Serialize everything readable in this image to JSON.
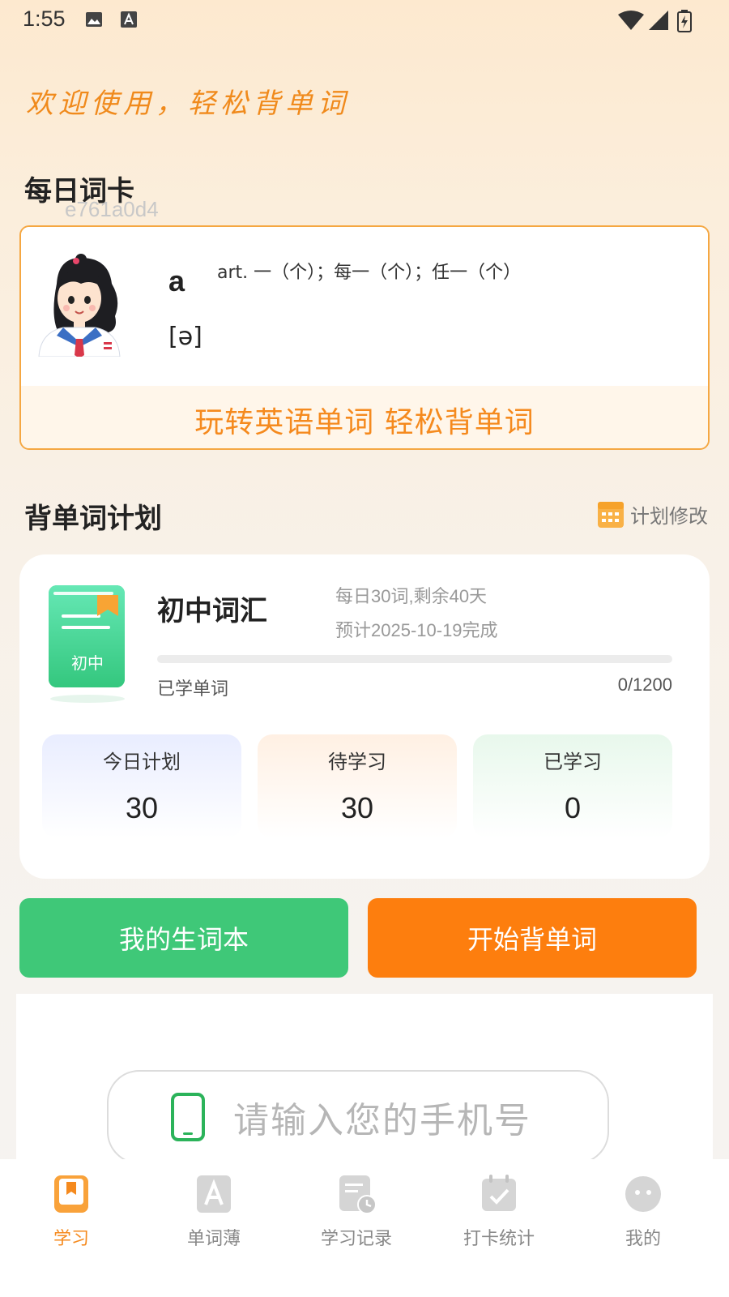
{
  "status_bar": {
    "time": "1:55"
  },
  "welcome_text": "欢迎使用，轻松背单词",
  "daily_card": {
    "title": "每日词卡",
    "subtitle": "e761a0d4",
    "word": "a",
    "meaning": "art. 一（个）；每一（个）；任一（个）",
    "phonetic": "[ə]",
    "slogan": "玩转英语单词  轻松背单词"
  },
  "plan": {
    "title": "背单词计划",
    "edit_label": "计划修改",
    "book_cover_label": "初中",
    "book_name": "初中词汇",
    "daily_info": "每日30词,剩余40天",
    "eta_info": "预计2025-10-19完成",
    "learned_label": "已学单词",
    "learned_count": "0/1200",
    "progress_fraction": 0,
    "stats": [
      {
        "label": "今日计划",
        "value": "30"
      },
      {
        "label": "待学习",
        "value": "30"
      },
      {
        "label": "已学习",
        "value": "0"
      }
    ]
  },
  "actions": {
    "vocab_book": "我的生词本",
    "start": "开始背单词"
  },
  "login": {
    "phone_placeholder": "请输入您的手机号"
  },
  "bottom_nav": [
    {
      "label": "学习",
      "icon": "book-icon",
      "active": true
    },
    {
      "label": "单词薄",
      "icon": "letter-a-icon",
      "active": false
    },
    {
      "label": "学习记录",
      "icon": "record-icon",
      "active": false
    },
    {
      "label": "打卡统计",
      "icon": "calendar-check-icon",
      "active": false
    },
    {
      "label": "我的",
      "icon": "profile-icon",
      "active": false
    }
  ],
  "colors": {
    "accent": "#f58a1e",
    "green": "#3fc878",
    "orange_button": "#fd7e0e"
  }
}
